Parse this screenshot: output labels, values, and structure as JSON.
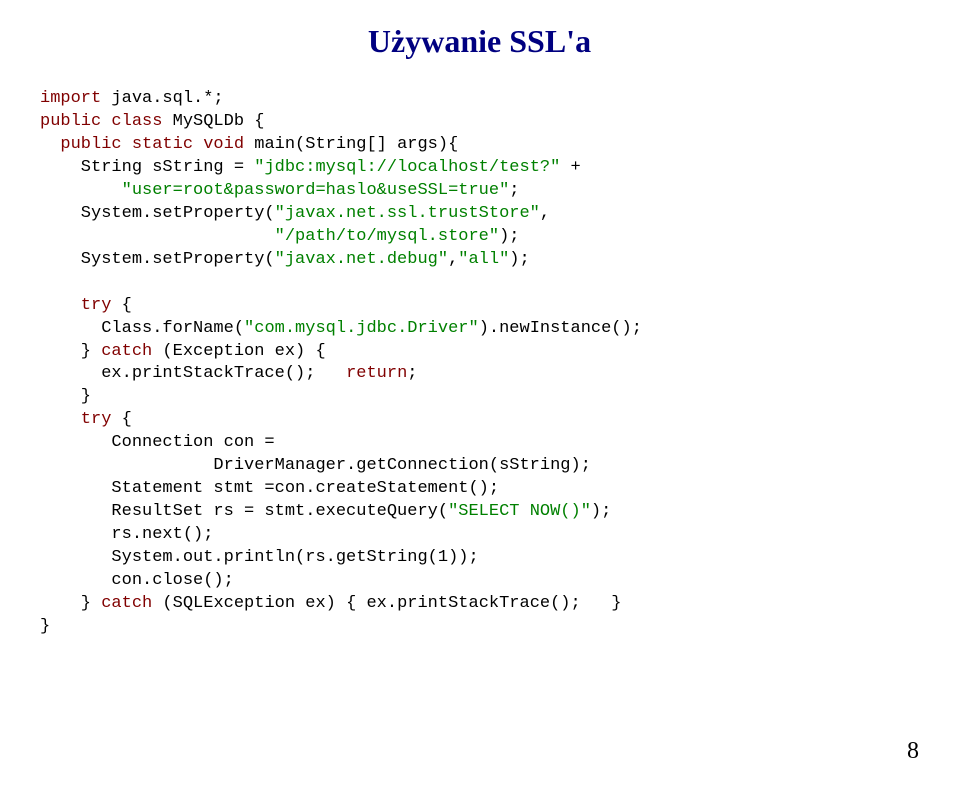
{
  "title": "Używanie SSL'a",
  "code": {
    "l1a": "import",
    "l1b": " java.sql.*;",
    "l2a": "public class",
    "l2b": " MySQLDb {",
    "l3a": "  public static void",
    "l3b": " main(String[] args){",
    "l4a": "    String sString = ",
    "l4b": "\"jdbc:mysql://localhost/test?\"",
    "l4c": " +",
    "l5a": "        ",
    "l5b": "\"user=root&password=haslo&useSSL=true\"",
    "l5c": ";",
    "l6a": "    System.setProperty(",
    "l6b": "\"javax.net.ssl.trustStore\"",
    "l6c": ",",
    "l7a": "                       ",
    "l7b": "\"/path/to/mysql.store\"",
    "l7c": ");",
    "l8a": "    System.setProperty(",
    "l8b": "\"javax.net.debug\"",
    "l8c": ",",
    "l8d": "\"all\"",
    "l8e": ");",
    "blank1": "",
    "l9a": "    try",
    "l9b": " {",
    "l10a": "      Class.forName(",
    "l10b": "\"com.mysql.jdbc.Driver\"",
    "l10c": ").newInstance();",
    "l11a": "    } ",
    "l11b": "catch",
    "l11c": " (Exception ex) {",
    "l12a": "      ex.printStackTrace();   ",
    "l12b": "return",
    "l12c": ";",
    "l13": "    }",
    "l14a": "    try",
    "l14b": " {",
    "l15": "       Connection con =",
    "l16": "                 DriverManager.getConnection(sString);",
    "l17": "       Statement stmt =con.createStatement();",
    "l18a": "       ResultSet rs = stmt.executeQuery(",
    "l18b": "\"SELECT NOW()\"",
    "l18c": ");",
    "l19": "       rs.next();",
    "l20": "       System.out.println(rs.getString(1));",
    "l21": "       con.close();",
    "l22a": "    } ",
    "l22b": "catch",
    "l22c": " (SQLException ex) { ex.printStackTrace();   }",
    "l23": "}"
  },
  "pagenum": "8"
}
